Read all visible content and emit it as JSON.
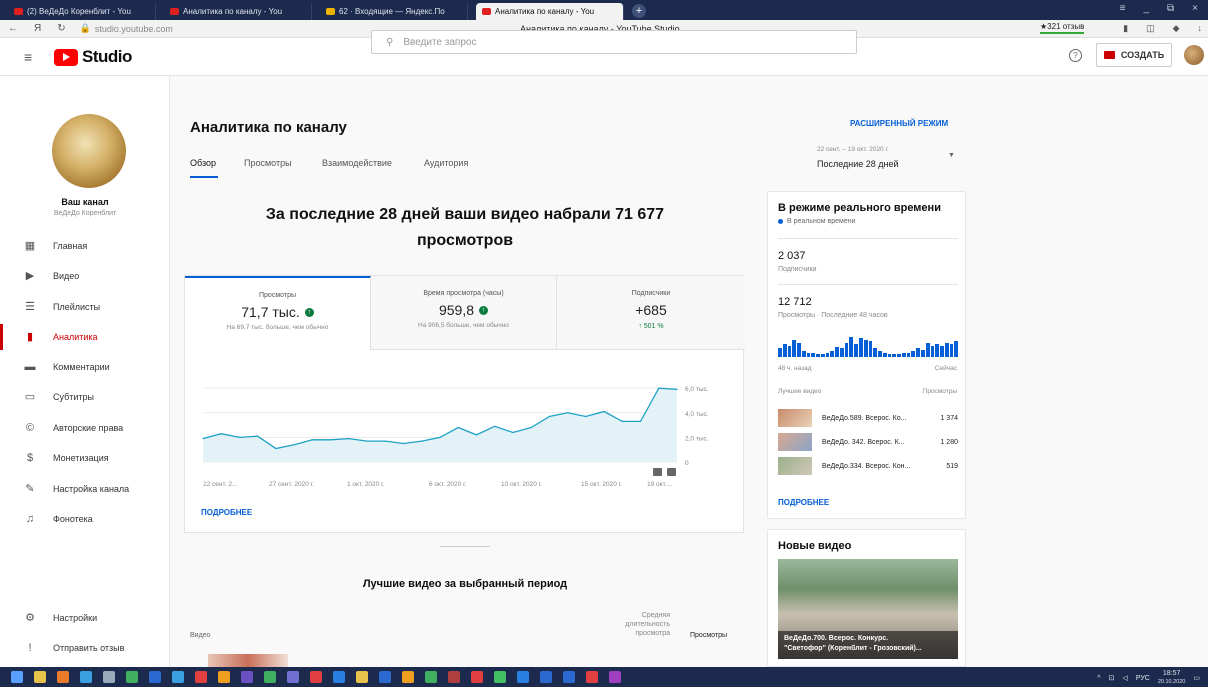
{
  "browser": {
    "tabs": [
      {
        "title": "(2) ВеДеДо Коренблит - You",
        "color": "#e02020"
      },
      {
        "title": "Аналитика по каналу - You",
        "color": "#e02020"
      },
      {
        "title": "62 · Входящие — Яндекс.По",
        "color": "#f0b400"
      },
      {
        "title": "Аналитика по каналу - You",
        "color": "#e02020"
      }
    ],
    "new_tab": "+",
    "window_controls": [
      "≡",
      "_",
      "⧉",
      "×"
    ],
    "url": "studio.youtube.com",
    "page_title": "Аналитика по каналу - YouTube Studio",
    "reviews": "★321 отзыв",
    "nav": {
      "back": "←",
      "yandex": "Я",
      "reload": "↻"
    }
  },
  "header": {
    "menu_icon": "≡",
    "logo_text": "Studio",
    "search_placeholder": "Введите запрос",
    "help_icon": "?",
    "create_label": "СОЗДАТЬ"
  },
  "sidebar": {
    "channel_name": "Ваш канал",
    "channel_sub": "ВеДеДо Коренблит",
    "items": [
      {
        "label": "Главная",
        "icon": "dashboard-icon",
        "glyph": "▦"
      },
      {
        "label": "Видео",
        "icon": "video-icon",
        "glyph": "▶"
      },
      {
        "label": "Плейлисты",
        "icon": "playlist-icon",
        "glyph": "☰"
      },
      {
        "label": "Аналитика",
        "icon": "analytics-icon",
        "glyph": "▮"
      },
      {
        "label": "Комментарии",
        "icon": "comments-icon",
        "glyph": "▬"
      },
      {
        "label": "Субтитры",
        "icon": "subtitles-icon",
        "glyph": "▭"
      },
      {
        "label": "Авторские права",
        "icon": "copyright-icon",
        "glyph": "©"
      },
      {
        "label": "Монетизация",
        "icon": "monetization-icon",
        "glyph": "$"
      },
      {
        "label": "Настройка канала",
        "icon": "customization-icon",
        "glyph": "✎"
      },
      {
        "label": "Фонотека",
        "icon": "audio-library-icon",
        "glyph": "♫"
      }
    ],
    "bottom": [
      {
        "label": "Настройки",
        "icon": "settings-icon",
        "glyph": "⚙"
      },
      {
        "label": "Отправить отзыв",
        "icon": "feedback-icon",
        "glyph": "!"
      }
    ]
  },
  "main": {
    "title": "Аналитика по каналу",
    "tabs": [
      "Обзор",
      "Просмотры",
      "Взаимодействие",
      "Аудитория"
    ],
    "headline_line1": "За последние 28 дней ваши видео набрали 71 677",
    "headline_line2": "просмотров",
    "stats": [
      {
        "label": "Просмотры",
        "value": "71,7 тыс.",
        "sub": "На 69,7 тыс. больше, чем обычно"
      },
      {
        "label": "Время просмотра (часы)",
        "value": "959,8",
        "sub": "На 906,5 больше, чем обычно"
      },
      {
        "label": "Подписчики",
        "value": "+685",
        "sub": "↑ 501 %"
      }
    ],
    "more": "ПОДРОБНЕЕ",
    "top_videos_title": "Лучшие видео за выбранный период",
    "col_video": "Видео",
    "col_avg": "Средняя длительность просмотра",
    "col_views": "Просмотры"
  },
  "chart_data": {
    "type": "area",
    "x": [
      "22 сент. 2...",
      "27 сент. 2020 г.",
      "1 окт. 2020 г.",
      "6 окт. 2020 г.",
      "10 окт. 2020 г.",
      "15 окт. 2020 г.",
      "19 окт...."
    ],
    "y_ticks": [
      "6,0 тыс.",
      "4,0 тыс.",
      "2,0 тыс.",
      "0"
    ],
    "ylim": [
      0,
      6500
    ],
    "values": [
      1900,
      2300,
      2000,
      2100,
      1100,
      1400,
      1800,
      1800,
      1900,
      1700,
      1700,
      1500,
      1700,
      2000,
      2800,
      2200,
      2900,
      2400,
      2800,
      3700,
      4000,
      3700,
      4100,
      3300,
      3300,
      6000,
      5900
    ],
    "color": "#1ea1c7",
    "fill": "#e3f2f7"
  },
  "realtime": {
    "title": "В режиме реального времени",
    "live_label": "В реальном времени",
    "subs_value": "2 037",
    "subs_label": "Подписчики",
    "views_value": "12 712",
    "views_label": "Просмотры · Последние 48 часов",
    "bars": [
      6,
      9,
      8,
      12,
      10,
      4,
      3,
      3,
      2,
      2,
      3,
      4,
      7,
      6,
      10,
      14,
      9,
      13,
      12,
      11,
      6,
      4,
      3,
      2,
      2,
      2,
      3,
      3,
      4,
      6,
      5,
      10,
      8,
      9,
      8,
      10,
      9,
      11
    ],
    "ago": "48 ч. назад",
    "now": "Сейчас",
    "best_label": "Лучшие видео",
    "views_col": "Просмотры",
    "videos": [
      {
        "title": "ВеДеДо.589. Всерос. Ко...",
        "views": "1 374"
      },
      {
        "title": "ВеДеДо. 342. Всерос. К...",
        "views": "1 280"
      },
      {
        "title": "ВеДеДо.334. Всерос. Кон...",
        "views": "519"
      }
    ],
    "more": "ПОДРОБНЕЕ"
  },
  "range": {
    "advanced": "РАСШИРЕННЫЙ РЕЖИМ",
    "dates": "22 сент. – 19 окт. 2020 г.",
    "period": "Последние 28 дней"
  },
  "new_videos": {
    "title": "Новые видео",
    "video_title_1": "ВеДеДо.700. Всерос. Конкурс.",
    "video_title_2": "\"Светофор\" (Коренблит - Грозовский)..."
  },
  "taskbar": {
    "tray_lang": "РУС",
    "time": "18:57",
    "date": "20.10.2020"
  }
}
